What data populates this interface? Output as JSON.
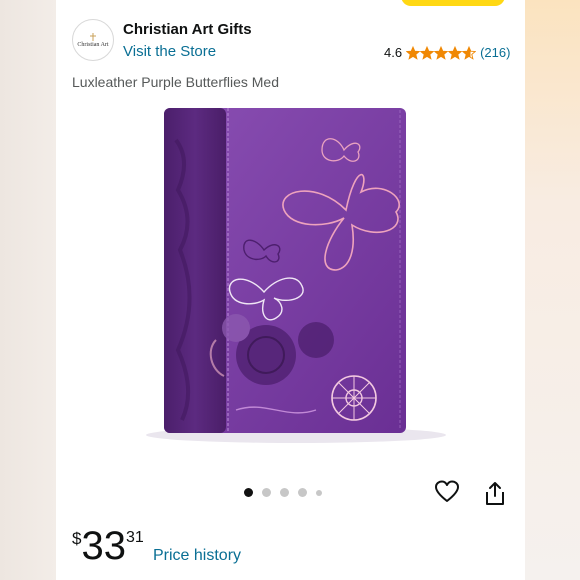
{
  "seller": {
    "logo_text": "Christian Art",
    "name": "Christian Art Gifts",
    "visit_store_label": "Visit the Store"
  },
  "rating": {
    "value": "4.6",
    "stars": 4.6,
    "count": "(216)"
  },
  "product": {
    "title": "Luxleather Purple Butterflies Med",
    "image_icon": "purple-bible-cover-with-butterflies"
  },
  "carousel": {
    "total_dots": 5,
    "active_index": 0
  },
  "actions": {
    "wishlist_icon": "heart-icon",
    "share_icon": "share-icon"
  },
  "price": {
    "symbol": "$",
    "whole": "33",
    "fraction": "31",
    "history_label": "Price history"
  },
  "colors": {
    "link": "#0a6f94",
    "star": "#f08804",
    "accent_button": "#ffd814",
    "cover_purple": "#7b3fa6"
  }
}
